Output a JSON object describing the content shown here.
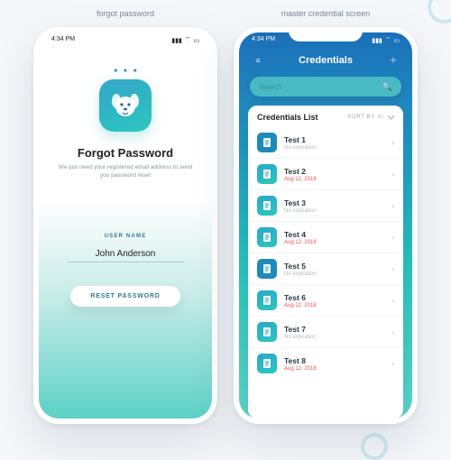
{
  "labels": {
    "forgot": "forgot password",
    "master": "master credential screen"
  },
  "statusbar": {
    "time": "4:34 PM"
  },
  "forgot": {
    "title": "Forgot Password",
    "subtitle": "We just need your registered email address to send you password reset",
    "fieldLabel": "USER NAME",
    "fieldValue": "John Anderson",
    "button": "RESET PASSWORD"
  },
  "credentials": {
    "headerTitle": "Credentials",
    "searchPlaceholder": "Search",
    "cardTitle": "Credentials List",
    "sortLabel": "SORT BY",
    "noExpiration": "No expiration",
    "items": [
      {
        "title": "Test 1",
        "sub": "No expiration",
        "variant": "noexp",
        "badge": "solid"
      },
      {
        "title": "Test 2",
        "sub": "Aug 12, 2018",
        "variant": "date",
        "badge": "grad"
      },
      {
        "title": "Test 3",
        "sub": "No expiration",
        "variant": "noexp",
        "badge": "grad"
      },
      {
        "title": "Test 4",
        "sub": "Aug 12, 2018",
        "variant": "date",
        "badge": "grad"
      },
      {
        "title": "Test 5",
        "sub": "No expiration",
        "variant": "noexp",
        "badge": "solid"
      },
      {
        "title": "Test 6",
        "sub": "Aug 12, 2018",
        "variant": "date",
        "badge": "grad"
      },
      {
        "title": "Test 7",
        "sub": "No expiration",
        "variant": "noexp",
        "badge": "grad"
      },
      {
        "title": "Test 8",
        "sub": "Aug 12, 2018",
        "variant": "date",
        "badge": "grad"
      }
    ]
  }
}
